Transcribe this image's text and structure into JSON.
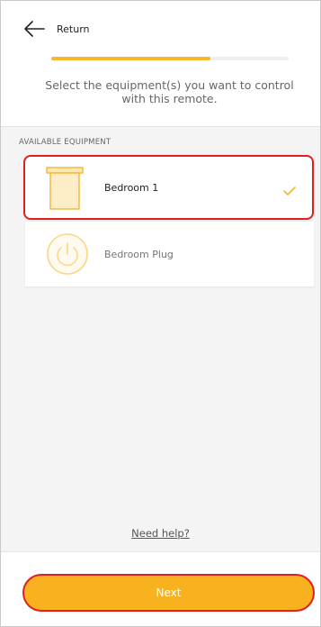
{
  "header": {
    "back_label": "Return",
    "progress_fraction": 0.67,
    "instruction": "Select the equipment(s) you want to control with this remote."
  },
  "section": {
    "label": "AVAILABLE EQUIPMENT"
  },
  "equipment": [
    {
      "label": "Bedroom 1",
      "icon": "window-shutter-icon",
      "selected": true
    },
    {
      "label": "Bedroom Plug",
      "icon": "power-plug-icon",
      "selected": false
    }
  ],
  "help": {
    "label": "Need help?"
  },
  "footer": {
    "next_label": "Next"
  },
  "colors": {
    "accent": "#f9b21f",
    "highlight_border": "#e02020",
    "background": "#f4f4f4"
  }
}
